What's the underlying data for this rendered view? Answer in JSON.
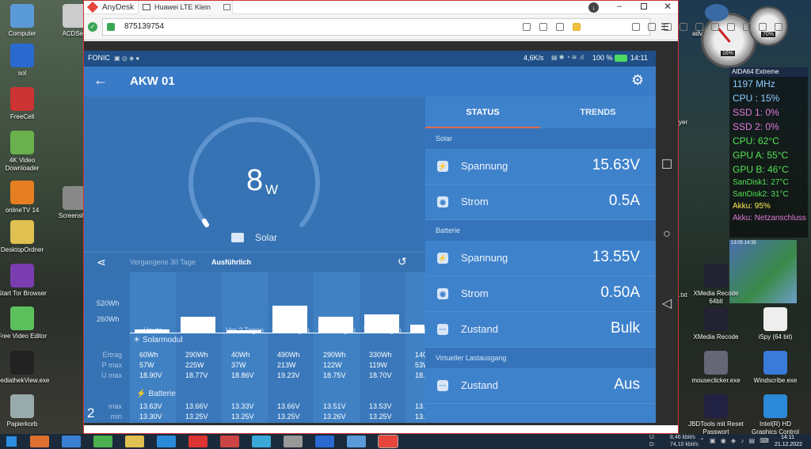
{
  "desktop": {
    "left_icons": [
      "Computer",
      "ACDSee",
      "sol",
      "FreeCell",
      "4K Video Downloader",
      "onlineTV 14",
      "Screenshot",
      "DesktopOrdner",
      "Start Tor Browser",
      "Free Video Editor",
      "MediathekView.exe",
      "Papierkorb"
    ],
    "right_icons": [
      "XMedia Recode 64bit",
      "XMedia Recode",
      "iSpy (64 bit)",
      "mouseclicker.exe",
      "Windscribe.exe",
      "JBDTools mit Reset Passwort",
      "Intel(R) HD Graphics Control Panel"
    ],
    "partial_labels": [
      "adv",
      "yer",
      ".txt"
    ],
    "gauge_labels": [
      "16%",
      "70%"
    ],
    "aida": {
      "title": "AIDA64 Extreme",
      "lines": [
        {
          "text": "1197 MHz",
          "color": "#8ecbff"
        },
        {
          "text": "CPU : 15%",
          "color": "#8ecbff"
        },
        {
          "text": "SSD 1: 0%",
          "color": "#e07ad8"
        },
        {
          "text": "SSD 2: 0%",
          "color": "#e07ad8"
        },
        {
          "text": "CPU: 62°C",
          "color": "#55e355"
        },
        {
          "text": "GPU A: 55°C",
          "color": "#55e355"
        },
        {
          "text": "GPU B: 46°C",
          "color": "#55e355"
        },
        {
          "text": "SanDisk1: 27°C",
          "color": "#55e355"
        },
        {
          "text": "SanDisk2: 31°C",
          "color": "#55e355"
        },
        {
          "text": "Akku: 95%",
          "color": "#ffee55"
        },
        {
          "text": "Akku: Netzanschluss",
          "color": "#e07ad8"
        }
      ]
    },
    "weather_time": "13:05 14:35"
  },
  "anydesk": {
    "app_name": "AnyDesk",
    "tab_label": "Huawei LTE Klein",
    "address": "875139754"
  },
  "phone": {
    "status_left": "FONIC",
    "status_speed": "4,6K/s",
    "status_battery": "100 %",
    "status_time": "14:11",
    "title": "AKW 01",
    "gauge_value": "8",
    "gauge_unit": "W",
    "gauge_source": "Solar",
    "history_tabs": [
      "Vergangene 30 Tage",
      "Ausführlich"
    ],
    "tabs": [
      "STATUS",
      "TRENDS"
    ],
    "sections": {
      "solar": {
        "title": "Solar",
        "rows": [
          {
            "label": "Spannung",
            "value": "15.63V",
            "icon": "lightning-icon"
          },
          {
            "label": "Strom",
            "value": "0.5A",
            "icon": "current-icon"
          }
        ]
      },
      "batterie": {
        "title": "Batterie",
        "rows": [
          {
            "label": "Spannung",
            "value": "13.55V",
            "icon": "lightning-icon"
          },
          {
            "label": "Strom",
            "value": "0.50A",
            "icon": "current-icon"
          },
          {
            "label": "Zustand",
            "value": "Bulk",
            "icon": "dots-icon"
          }
        ]
      },
      "load": {
        "title": "Virtueller Lastausgang",
        "rows": [
          {
            "label": "Zustand",
            "value": "Aus",
            "icon": "dots-icon"
          }
        ]
      }
    },
    "history": {
      "y_ticks": [
        "520Wh",
        "260Wh"
      ],
      "days": [
        "Heute",
        "Gestern",
        "Vor 2 Tagen",
        "Vor 3 Tagen",
        "Vor 4 Tagen",
        "Vor 5 Tagen",
        "Vor 6"
      ],
      "solar_label": "Solarmodul",
      "solar_row_labels": [
        "Ertrag",
        "P max",
        "U max"
      ],
      "ertrag_wh": [
        60,
        290,
        40,
        490,
        290,
        330,
        140
      ],
      "ertrag": [
        "60Wh",
        "290Wh",
        "40Wh",
        "490Wh",
        "290Wh",
        "330Wh",
        "140"
      ],
      "pmax": [
        "57W",
        "225W",
        "37W",
        "213W",
        "122W",
        "119W",
        "53W"
      ],
      "umax": [
        "18.90V",
        "18.77V",
        "18.86V",
        "19.23V",
        "18.75V",
        "18.70V",
        "18."
      ],
      "battery_label": "Batterie",
      "battery_row_labels": [
        "max",
        "min"
      ],
      "bmax": [
        "13.63V",
        "13.66V",
        "13.33V",
        "13.66V",
        "13.51V",
        "13.53V",
        "13."
      ],
      "bmin": [
        "13.30V",
        "13.25V",
        "13.25V",
        "13.25V",
        "13.26V",
        "13.25V",
        "13."
      ],
      "overlay_digit": "2"
    }
  },
  "taskbar": {
    "net_up": "8,46 kbit/s",
    "net_down": "74,10 kbit/s",
    "net_labels": [
      "U:",
      "D:"
    ],
    "time": "14:11",
    "date": "21.12.2022"
  }
}
